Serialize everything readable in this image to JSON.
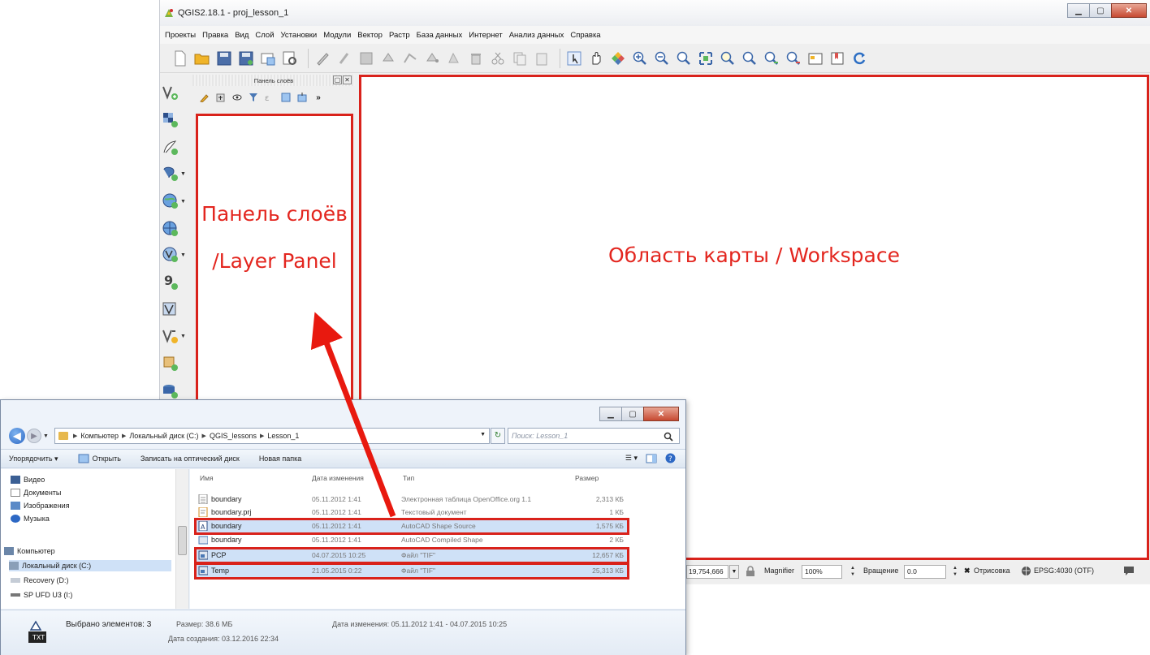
{
  "qgis": {
    "title": "QGIS2.18.1 - proj_lesson_1",
    "menu": [
      "Проекты",
      "Правка",
      "Вид",
      "Слой",
      "Установки",
      "Модули",
      "Вектор",
      "Растр",
      "База данных",
      "Интернет",
      "Анализ данных",
      "Справка"
    ],
    "panel_title": "Панель слоёв",
    "layer_panel_label_1": "Панель слоёв",
    "layer_panel_label_2": "/Layer Panel",
    "workspace_label": "Область карты / Workspace",
    "status": {
      "scale": "19,754,666",
      "magnifier_label": "Magnifier",
      "magnifier_value": "100%",
      "rotation_label": "Вращение",
      "rotation_value": "0.0",
      "render_label": "Отрисовка",
      "crs": "EPSG:4030 (OTF)"
    }
  },
  "explorer": {
    "breadcrumb": [
      "Компьютер",
      "Локальный диск (C:)",
      "QGIS_lessons",
      "Lesson_1"
    ],
    "search_placeholder": "Поиск: Lesson_1",
    "commands": [
      "Упорядочить ▾",
      "Открыть",
      "Записать на оптический диск",
      "Новая папка"
    ],
    "nav": [
      {
        "label": "Видео",
        "icon": "video-library-icon"
      },
      {
        "label": "Документы",
        "icon": "documents-icon"
      },
      {
        "label": "Изображения",
        "icon": "pictures-icon"
      },
      {
        "label": "Музыка",
        "icon": "music-icon"
      },
      {
        "label": "Компьютер",
        "icon": "computer-icon"
      },
      {
        "label": "Локальный диск (C:)",
        "icon": "drive-icon"
      },
      {
        "label": "Recovery (D:)",
        "icon": "drive-icon"
      },
      {
        "label": "SP UFD U3 (I:)",
        "icon": "usb-drive-icon"
      }
    ],
    "columns": {
      "name": "Имя",
      "date": "Дата изменения",
      "type": "Тип",
      "size": "Размер"
    },
    "files": [
      {
        "name": "boundary",
        "date": "05.11.2012 1:41",
        "type": "Электронная таблица OpenOffice.org 1.1",
        "size": "2,313 КБ",
        "selected": false
      },
      {
        "name": "boundary.prj",
        "date": "05.11.2012 1:41",
        "type": "Текстовый документ",
        "size": "1 КБ",
        "selected": false
      },
      {
        "name": "boundary",
        "date": "05.11.2012 1:41",
        "type": "AutoCAD Shape Source",
        "size": "1,575 КБ",
        "selected": true
      },
      {
        "name": "boundary",
        "date": "05.11.2012 1:41",
        "type": "AutoCAD Compiled Shape",
        "size": "2 КБ",
        "selected": false
      },
      {
        "name": "PCP",
        "date": "04.07.2015 10:25",
        "type": "Файл \"TIF\"",
        "size": "12,657 КБ",
        "selected": true
      },
      {
        "name": "Temp",
        "date": "21.05.2015 0:22",
        "type": "Файл \"TIF\"",
        "size": "25,313 КБ",
        "selected": true
      }
    ],
    "details": {
      "selected": "Выбрано элементов: 3",
      "size": "Размер: 38.6 МБ",
      "modified": "Дата изменения: 05.11.2012 1:41 - 04.07.2015 10:25",
      "created": "Дата создания: 03.12.2016 22:34"
    }
  },
  "colors": {
    "annotation_red": "#d9221b",
    "annotation_text": "#e3261f",
    "selection": "#cfe1f7"
  }
}
